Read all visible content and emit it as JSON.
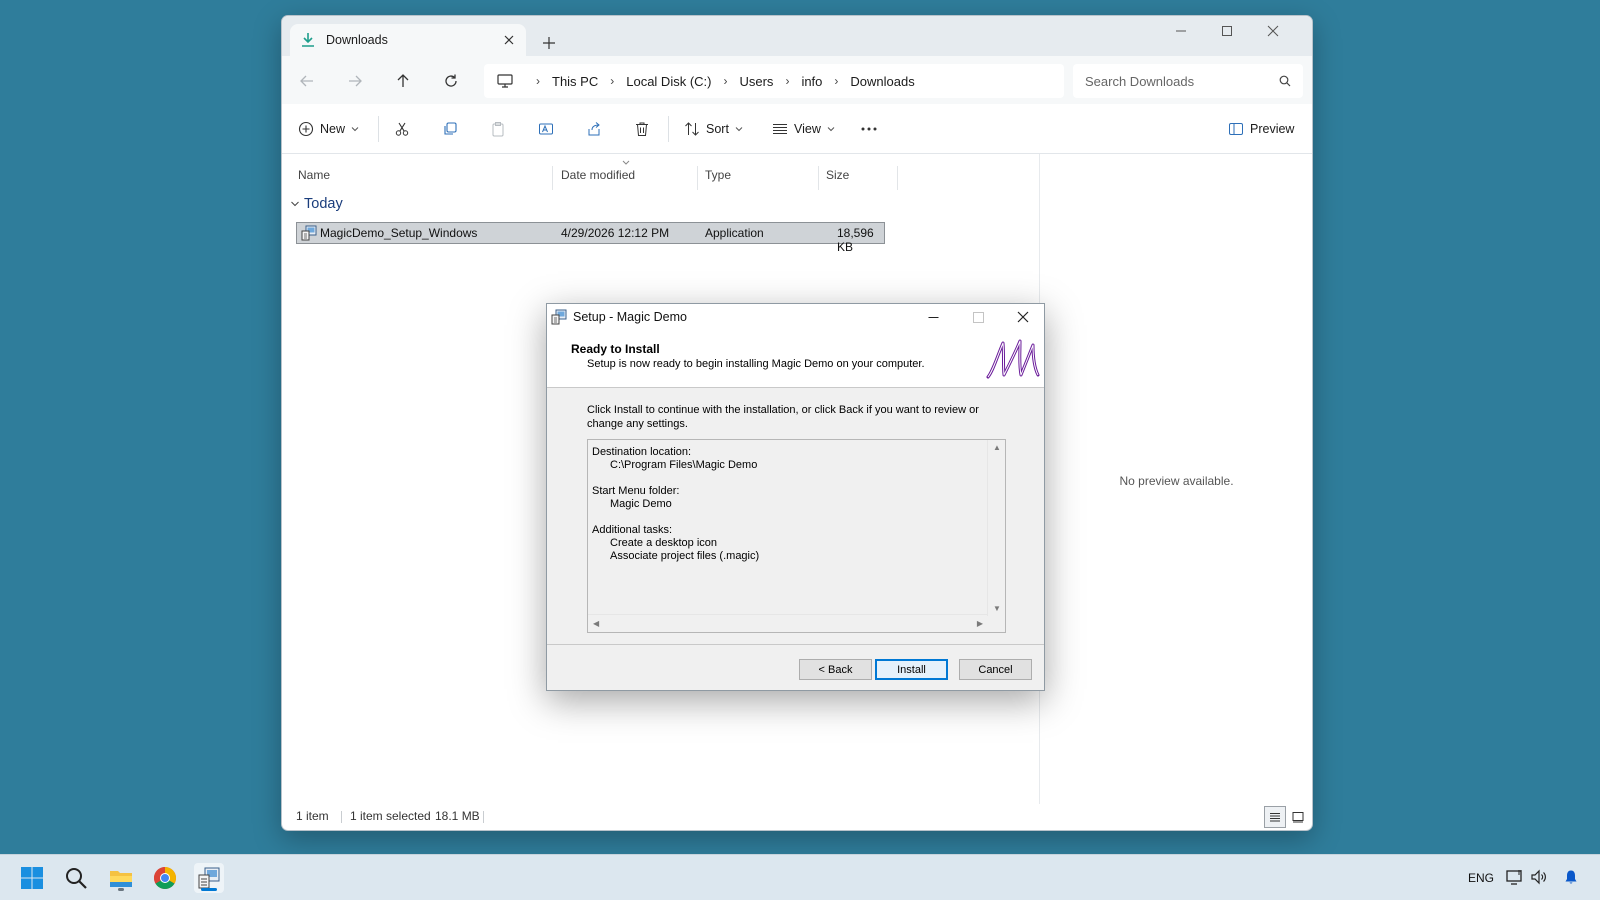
{
  "explorer": {
    "tab_title": "Downloads",
    "breadcrumb": [
      "This PC",
      "Local Disk (C:)",
      "Users",
      "info",
      "Downloads"
    ],
    "search_placeholder": "Search Downloads",
    "toolbar": {
      "new_label": "New",
      "sort_label": "Sort",
      "view_label": "View",
      "preview_label": "Preview"
    },
    "columns": {
      "name": "Name",
      "date": "Date modified",
      "type": "Type",
      "size": "Size"
    },
    "group_label": "Today",
    "file": {
      "name": "MagicDemo_Setup_Windows",
      "date": "4/29/2026 12:12 PM",
      "type": "Application",
      "size": "18,596 KB"
    },
    "preview_text": "No preview available.",
    "status": {
      "count": "1 item",
      "selected": "1 item selected",
      "selected_size": "18.1 MB"
    }
  },
  "setup": {
    "title": "Setup - Magic Demo",
    "heading": "Ready to Install",
    "subheading": "Setup is now ready to begin installing Magic Demo on your computer.",
    "intro": "Click Install to continue with the installation, or click Back if you want to review or change any settings.",
    "memo": {
      "dest_label": "Destination location:",
      "dest_value": "C:\\Program Files\\Magic Demo",
      "start_label": "Start Menu folder:",
      "start_value": "Magic Demo",
      "tasks_label": "Additional tasks:",
      "task1": "Create a desktop icon",
      "task2": "Associate project files (.magic)"
    },
    "buttons": {
      "back": "< Back",
      "install": "Install",
      "cancel": "Cancel"
    }
  },
  "taskbar": {
    "icons": [
      "windows-start-icon",
      "search-icon",
      "file-explorer-icon",
      "chrome-icon",
      "setup-app-icon"
    ],
    "language": "ENG"
  },
  "colors": {
    "desktop": "#2f7d9b",
    "accent": "#0078d4",
    "selection": "#cfd3d7",
    "logo_purple": "#6a1b9a"
  }
}
